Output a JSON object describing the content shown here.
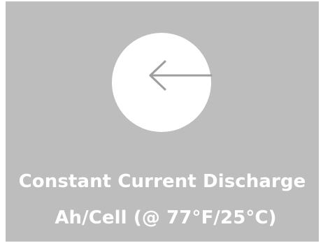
{
  "card": {
    "icon": "arrow-left-icon",
    "title_line1": "Constant Current Discharge",
    "title_line2": "Ah/Cell (@ 77°F/25°C)",
    "background_color": "#bdbdbd",
    "icon_circle_color": "#ffffff",
    "icon_stroke_color": "#9e9e9e",
    "text_color": "#ffffff"
  }
}
